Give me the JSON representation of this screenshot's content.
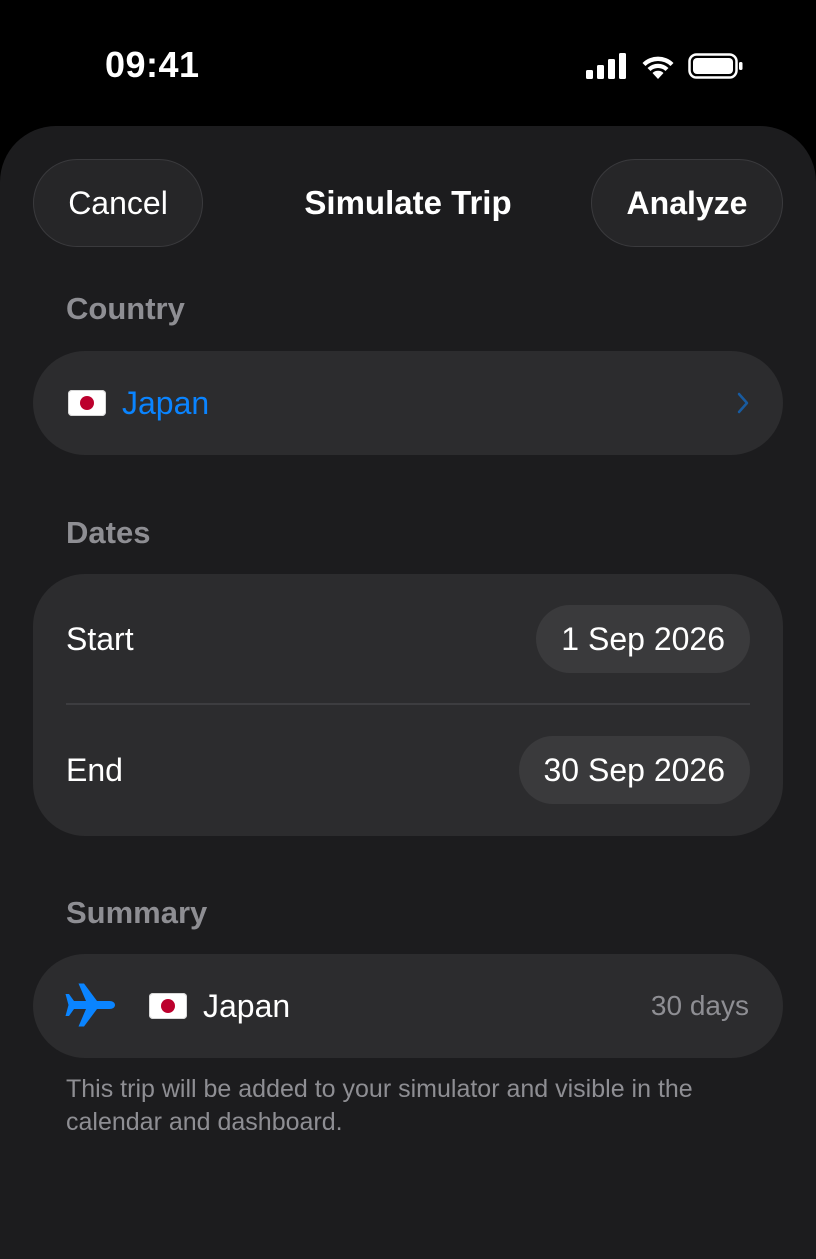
{
  "status_bar": {
    "time": "09:41",
    "icons": [
      "cellular-signal-icon",
      "wifi-icon",
      "battery-icon"
    ]
  },
  "nav": {
    "cancel_label": "Cancel",
    "title": "Simulate Trip",
    "analyze_label": "Analyze"
  },
  "country": {
    "section_label": "Country",
    "flag_icon": "japan-flag-icon",
    "value": "Japan",
    "accent_color": "#0a84ff"
  },
  "dates": {
    "section_label": "Dates",
    "start_label": "Start",
    "start_value": "1 Sep 2026",
    "end_label": "End",
    "end_value": "30 Sep 2026"
  },
  "summary": {
    "section_label": "Summary",
    "icon": "airplane-icon",
    "flag_icon": "japan-flag-icon",
    "country": "Japan",
    "duration": "30 days",
    "footnote": "This trip will be added to your simulator and visible in the calendar and dashboard."
  }
}
